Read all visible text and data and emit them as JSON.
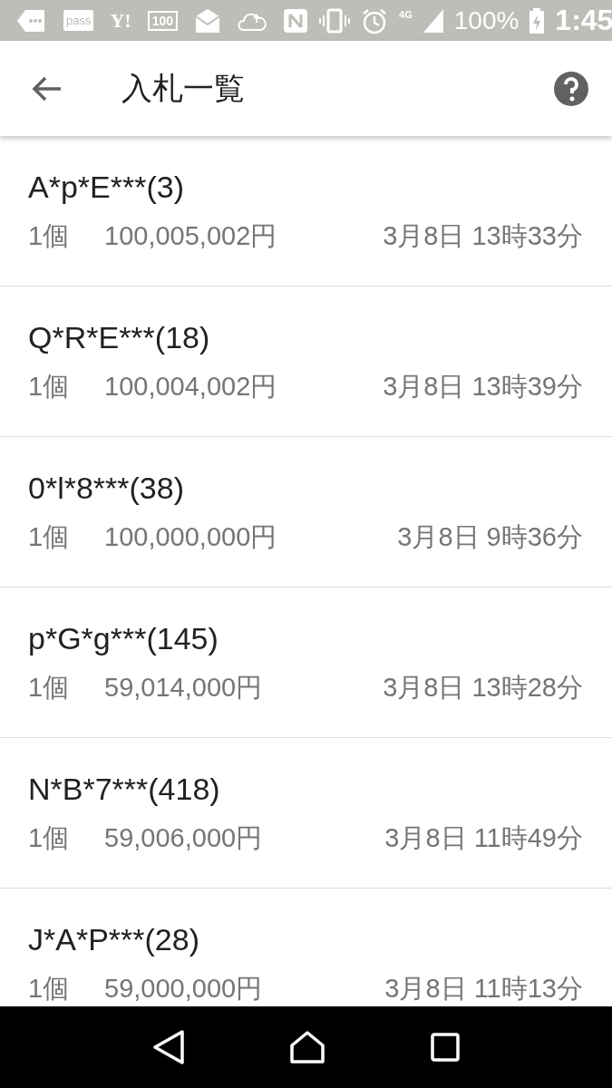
{
  "status_bar": {
    "icon_labels": [
      "pass",
      "Y!",
      "100"
    ],
    "network": "4G",
    "battery": "100%",
    "time": "1:45"
  },
  "header": {
    "title": "入札一覧"
  },
  "bids": [
    {
      "bidder": "A*p*E***(3)",
      "quantity": "1個",
      "price": "100,005,002円",
      "datetime": "3月8日 13時33分"
    },
    {
      "bidder": "Q*R*E***(18)",
      "quantity": "1個",
      "price": "100,004,002円",
      "datetime": "3月8日 13時39分"
    },
    {
      "bidder": "0*l*8***(38)",
      "quantity": "1個",
      "price": "100,000,000円",
      "datetime": "3月8日 9時36分"
    },
    {
      "bidder": "p*G*g***(145)",
      "quantity": "1個",
      "price": "59,014,000円",
      "datetime": "3月8日 13時28分"
    },
    {
      "bidder": "N*B*7***(418)",
      "quantity": "1個",
      "price": "59,006,000円",
      "datetime": "3月8日 11時49分"
    },
    {
      "bidder": "J*A*P***(28)",
      "quantity": "1個",
      "price": "59,000,000円",
      "datetime": "3月8日 11時13分"
    }
  ]
}
